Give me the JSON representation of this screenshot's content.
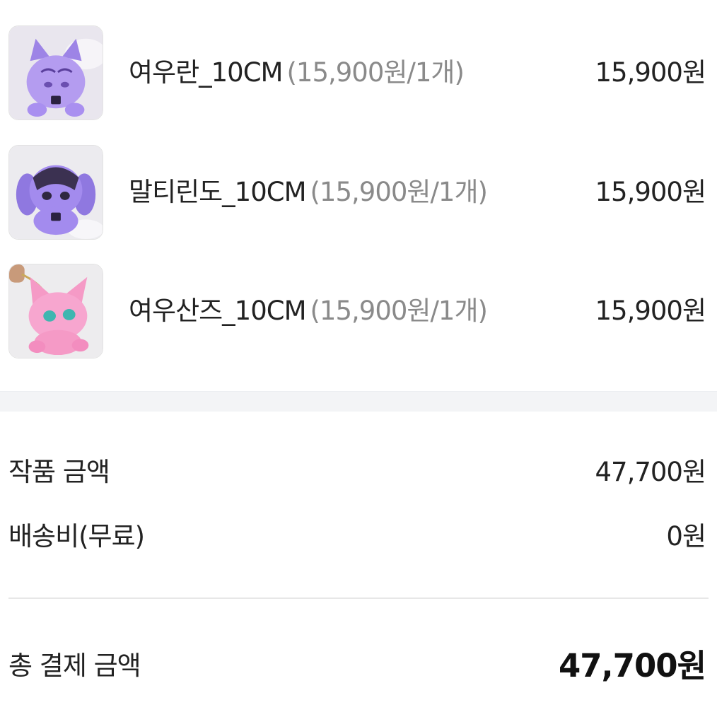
{
  "items": [
    {
      "name": "여우란_10CM",
      "detail": "(15,900원/1개)",
      "price": "15,900원",
      "thumbnail_icon": "purple-fox-plush-thumbnail",
      "plush_color": "#b49cf0"
    },
    {
      "name": "말티린도_10CM",
      "detail": "(15,900원/1개)",
      "price": "15,900원",
      "thumbnail_icon": "purple-dog-plush-thumbnail",
      "plush_color": "#a38bee"
    },
    {
      "name": "여우산즈_10CM",
      "detail": "(15,900원/1개)",
      "price": "15,900원",
      "thumbnail_icon": "pink-fox-plush-thumbnail",
      "plush_color": "#f59ac6"
    }
  ],
  "summary": {
    "product_amount_label": "작품 금액",
    "product_amount_value": "47,700원",
    "shipping_label": "배송비(무료)",
    "shipping_value": "0원",
    "total_label": "총 결제 금액",
    "total_value": "47,700원"
  },
  "colors": {
    "text": "#222222",
    "muted": "#8a8a8a",
    "band": "#f3f4f6",
    "divider": "#e7e7e7"
  }
}
